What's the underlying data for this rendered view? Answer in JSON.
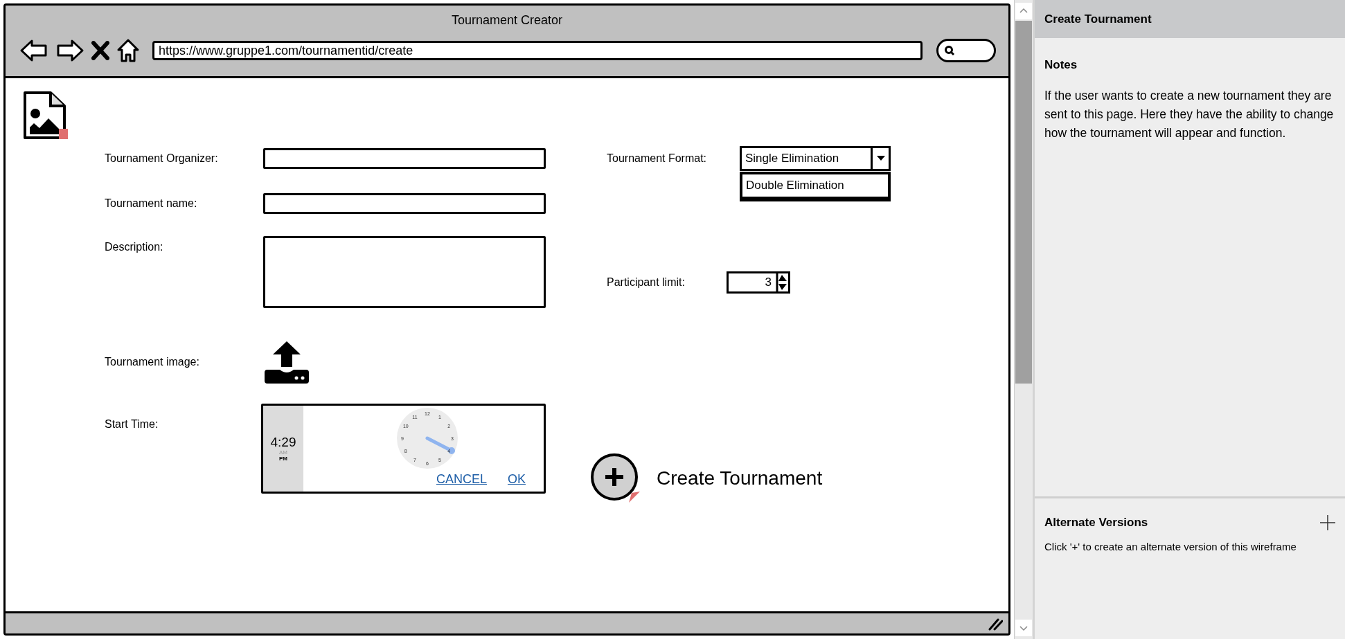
{
  "window": {
    "title": "Tournament Creator",
    "url": "https://www.gruppe1.com/tournamentid/create"
  },
  "form": {
    "fields": [
      {
        "kind": "text",
        "label": "Tournament Organizer:"
      },
      {
        "kind": "text",
        "label": "Tournament name:"
      },
      {
        "kind": "textarea",
        "label": "Description:"
      },
      {
        "kind": "upload",
        "label": "Tournament image:"
      },
      {
        "kind": "time",
        "label": "Start Time:"
      }
    ],
    "format": {
      "label": "Tournament Format:",
      "value": "Single Elimination",
      "expanded": true,
      "options": [
        "Double Elimination"
      ]
    },
    "participant_limit": {
      "label": "Participant limit:",
      "value": "3"
    },
    "time_picker": {
      "time": "4:29",
      "periods": [
        {
          "label": "AM",
          "selected": false
        },
        {
          "label": "PM",
          "selected": true
        }
      ],
      "clock_numbers": [
        "12",
        "1",
        "2",
        "3",
        "4",
        "5",
        "6",
        "7",
        "8",
        "9",
        "10",
        "11"
      ],
      "buttons": [
        "CANCEL",
        "OK"
      ]
    },
    "create_button": "Create Tournament"
  },
  "panel": {
    "title": "Create Tournament",
    "notes_heading": "Notes",
    "notes": "If the user wants to create a new tournament they are sent to this page. Here they have the ability to change how the tournament will appear and function.",
    "alternate_heading": "Alternate Versions",
    "alternate_text": "Click '+' to create an alternate version of this wireframe"
  }
}
